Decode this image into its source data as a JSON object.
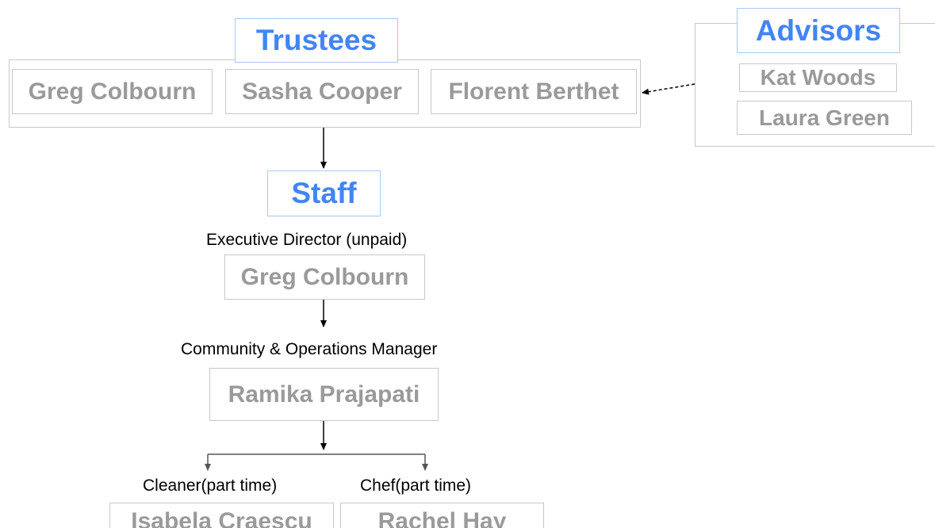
{
  "trustees": {
    "heading": "Trustees",
    "members": [
      "Greg Colbourn",
      "Sasha Cooper",
      "Florent Berthet"
    ]
  },
  "advisors": {
    "heading": "Advisors",
    "members": [
      "Kat Woods",
      "Laura Green"
    ]
  },
  "staff": {
    "heading": "Staff",
    "executive_director": {
      "role": "Executive Director (unpaid)",
      "name": "Greg Colbourn"
    },
    "manager": {
      "role": "Community & Operations Manager",
      "name": "Ramika Prajapati"
    },
    "cleaner": {
      "role": "Cleaner(part time)",
      "name": "Isabela Craescu"
    },
    "chef": {
      "role": "Chef(part time)",
      "name": "Rachel Hay"
    }
  },
  "colors": {
    "heading_text": "#4285f4",
    "heading_border": "#a9c7f2",
    "name_text": "#9a9a9a",
    "box_border": "#c8c8c8",
    "role_text": "#000000",
    "connector": "#000000"
  }
}
